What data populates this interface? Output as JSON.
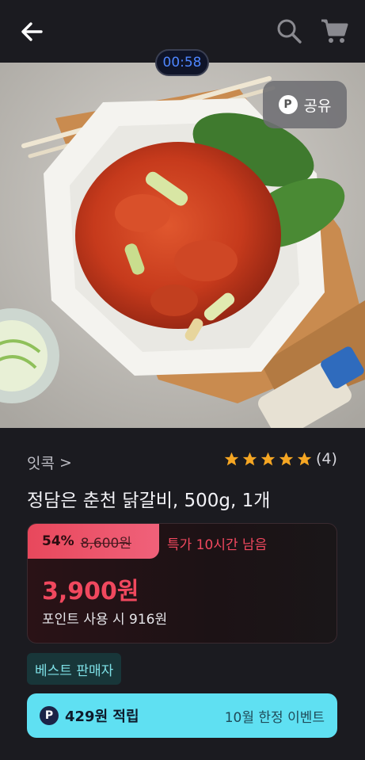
{
  "header": {
    "back_icon": "arrow-left-icon",
    "search_icon": "search-icon",
    "cart_icon": "cart-icon"
  },
  "timer": "00:58",
  "hero": {
    "share_label": "공유",
    "share_badge": "P",
    "image": "dakgalbi-plate-photo"
  },
  "product": {
    "brand": "잇콕",
    "brand_chevron": ">",
    "rating_count": "(4)",
    "rating_stars": 5,
    "title": "정담은 춘천 닭갈비, 500g, 1개"
  },
  "price": {
    "discount_pct": "54%",
    "original": "8,600원",
    "deal_text": "특가 10시간 남음",
    "sale": "3,900원",
    "point_price": "포인트 사용 시 916원"
  },
  "badge": {
    "best_seller": "베스트 판매자"
  },
  "reward": {
    "badge": "P",
    "amount": "429원 적립",
    "event": "10월 한정 이벤트"
  },
  "colors": {
    "accent_red": "#f0485e",
    "reward_bg": "#5fe0f2",
    "star": "#f5a623",
    "timer_text": "#4e86ff"
  }
}
